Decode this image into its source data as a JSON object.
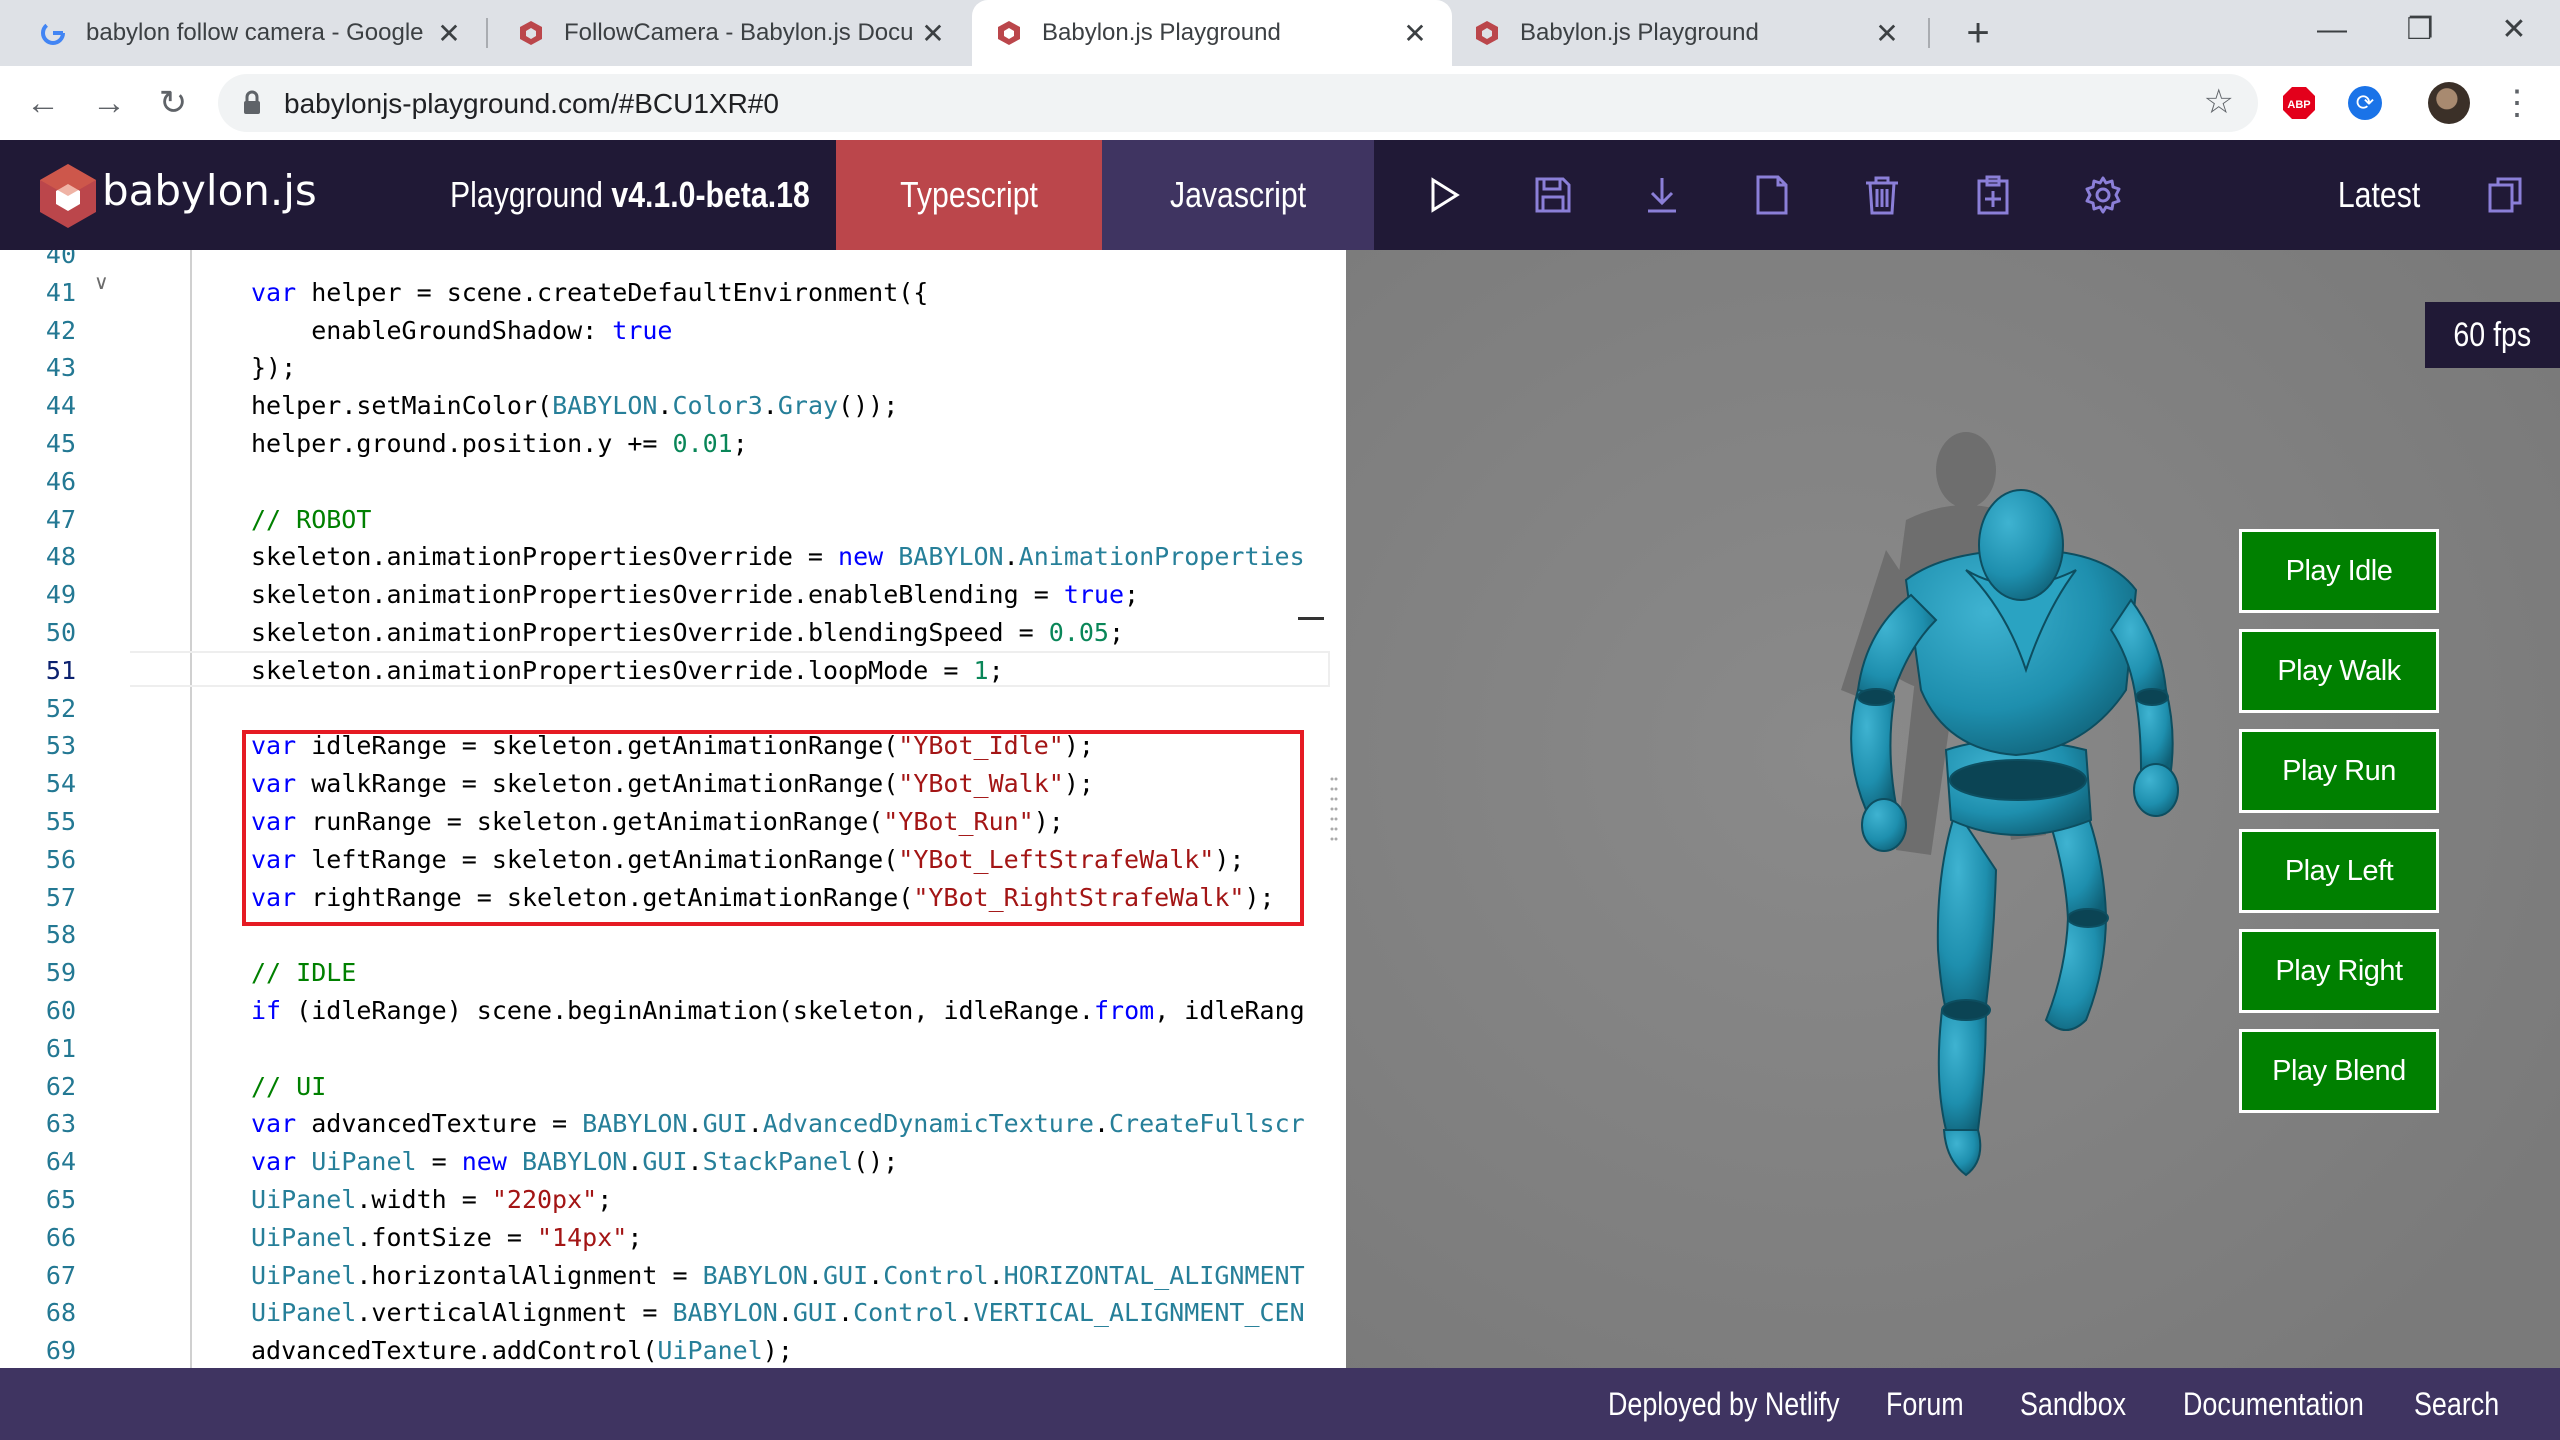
{
  "browser": {
    "tabs": [
      {
        "title": "babylon follow camera - Google",
        "icon": "google-icon"
      },
      {
        "title": "FollowCamera - Babylon.js Docu",
        "icon": "babylon-icon"
      },
      {
        "title": "Babylon.js Playground",
        "icon": "babylon-icon",
        "active": true
      },
      {
        "title": "Babylon.js Playground",
        "icon": "babylon-icon"
      }
    ],
    "new_tab": "+",
    "url": "babylonjs-playground.com/#BCU1XR#0",
    "ext_abp": "ABP"
  },
  "header": {
    "logo": "babylon.js",
    "version_prefix": "Playground ",
    "version": "v4.1.0-beta.18",
    "tab_typescript": "Typescript",
    "tab_javascript": "Javascript",
    "latest": "Latest"
  },
  "editor": {
    "lines": [
      {
        "n": "40",
        "code": ""
      },
      {
        "n": "41",
        "code": "var helper = scene.createDefaultEnvironment({"
      },
      {
        "n": "42",
        "code": "    enableGroundShadow: true"
      },
      {
        "n": "43",
        "code": "});"
      },
      {
        "n": "44",
        "code": "helper.setMainColor(BABYLON.Color3.Gray());"
      },
      {
        "n": "45",
        "code": "helper.ground.position.y += 0.01;"
      },
      {
        "n": "46",
        "code": ""
      },
      {
        "n": "47",
        "code": "// ROBOT"
      },
      {
        "n": "48",
        "code": "skeleton.animationPropertiesOverride = new BABYLON.AnimationProperties"
      },
      {
        "n": "49",
        "code": "skeleton.animationPropertiesOverride.enableBlending = true;"
      },
      {
        "n": "50",
        "code": "skeleton.animationPropertiesOverride.blendingSpeed = 0.05;"
      },
      {
        "n": "51",
        "code": "skeleton.animationPropertiesOverride.loopMode = 1;"
      },
      {
        "n": "52",
        "code": ""
      },
      {
        "n": "53",
        "code": "var idleRange = skeleton.getAnimationRange(\"YBot_Idle\");"
      },
      {
        "n": "54",
        "code": "var walkRange = skeleton.getAnimationRange(\"YBot_Walk\");"
      },
      {
        "n": "55",
        "code": "var runRange = skeleton.getAnimationRange(\"YBot_Run\");"
      },
      {
        "n": "56",
        "code": "var leftRange = skeleton.getAnimationRange(\"YBot_LeftStrafeWalk\");"
      },
      {
        "n": "57",
        "code": "var rightRange = skeleton.getAnimationRange(\"YBot_RightStrafeWalk\");"
      },
      {
        "n": "58",
        "code": ""
      },
      {
        "n": "59",
        "code": "// IDLE"
      },
      {
        "n": "60",
        "code": "if (idleRange) scene.beginAnimation(skeleton, idleRange.from, idleRang"
      },
      {
        "n": "61",
        "code": ""
      },
      {
        "n": "62",
        "code": "// UI"
      },
      {
        "n": "63",
        "code": "var advancedTexture = BABYLON.GUI.AdvancedDynamicTexture.CreateFullscr"
      },
      {
        "n": "64",
        "code": "var UiPanel = new BABYLON.GUI.StackPanel();"
      },
      {
        "n": "65",
        "code": "UiPanel.width = \"220px\";"
      },
      {
        "n": "66",
        "code": "UiPanel.fontSize = \"14px\";"
      },
      {
        "n": "67",
        "code": "UiPanel.horizontalAlignment = BABYLON.GUI.Control.HORIZONTAL_ALIGNMENT"
      },
      {
        "n": "68",
        "code": "UiPanel.verticalAlignment = BABYLON.GUI.Control.VERTICAL_ALIGNMENT_CEN"
      },
      {
        "n": "69",
        "code": "advancedTexture.addControl(UiPanel);"
      }
    ]
  },
  "scene": {
    "fps": "60 fps",
    "buttons": [
      "Play Idle",
      "Play Walk",
      "Play Run",
      "Play Left",
      "Play Right",
      "Play Blend"
    ],
    "robot_color": "#1e8fae",
    "background_color": "#838383",
    "button_color": "#008000"
  },
  "footer": {
    "links": [
      "Deployed by Netlify",
      "Forum",
      "Sandbox",
      "Documentation",
      "Search"
    ]
  }
}
